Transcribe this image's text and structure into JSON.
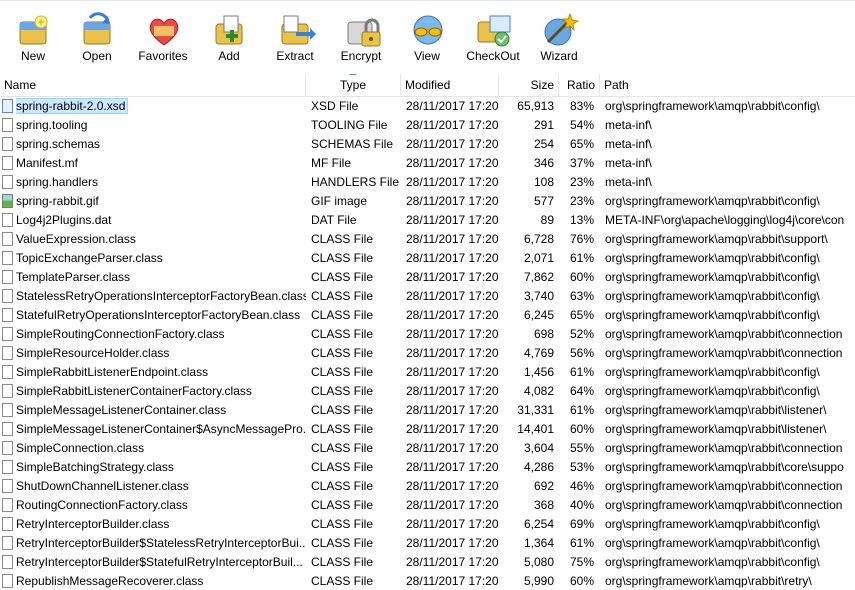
{
  "toolbar": {
    "items": [
      {
        "label": "New",
        "icon": "new-archive-icon"
      },
      {
        "label": "Open",
        "icon": "open-archive-icon"
      },
      {
        "label": "Favorites",
        "icon": "favorites-heart-icon"
      },
      {
        "label": "Add",
        "icon": "add-files-icon"
      },
      {
        "label": "Extract",
        "icon": "extract-icon"
      },
      {
        "label": "Encrypt",
        "icon": "encrypt-lock-icon"
      },
      {
        "label": "View",
        "icon": "view-glasses-icon"
      },
      {
        "label": "CheckOut",
        "icon": "checkout-icon"
      },
      {
        "label": "Wizard",
        "icon": "wizard-icon"
      }
    ]
  },
  "columns": {
    "name": "Name",
    "type": "Type",
    "modified": "Modified",
    "size": "Size",
    "ratio": "Ratio",
    "path": "Path"
  },
  "colors": {
    "selection": "#cce8ff",
    "selection_border": "#99d1ff",
    "sort_arrow": "#5a8fc8"
  },
  "files": [
    {
      "name": "spring-rabbit-2.0.xsd",
      "type": "XSD File",
      "modified": "28/11/2017 17:20",
      "size": "65,913",
      "ratio": "83%",
      "path": "org\\springframework\\amqp\\rabbit\\config\\",
      "icon": "xsd-file-icon",
      "selected": true
    },
    {
      "name": "spring.tooling",
      "type": "TOOLING File",
      "modified": "28/11/2017 17:20",
      "size": "291",
      "ratio": "54%",
      "path": "meta-inf\\",
      "icon": "file-icon"
    },
    {
      "name": "spring.schemas",
      "type": "SCHEMAS File",
      "modified": "28/11/2017 17:20",
      "size": "254",
      "ratio": "65%",
      "path": "meta-inf\\",
      "icon": "file-icon"
    },
    {
      "name": "Manifest.mf",
      "type": "MF File",
      "modified": "28/11/2017 17:20",
      "size": "346",
      "ratio": "37%",
      "path": "meta-inf\\",
      "icon": "file-icon"
    },
    {
      "name": "spring.handlers",
      "type": "HANDLERS File",
      "modified": "28/11/2017 17:20",
      "size": "108",
      "ratio": "23%",
      "path": "meta-inf\\",
      "icon": "file-icon"
    },
    {
      "name": "spring-rabbit.gif",
      "type": "GIF image",
      "modified": "28/11/2017 17:20",
      "size": "577",
      "ratio": "23%",
      "path": "org\\springframework\\amqp\\rabbit\\config\\",
      "icon": "image-file-icon"
    },
    {
      "name": "Log4j2Plugins.dat",
      "type": "DAT File",
      "modified": "28/11/2017 17:20",
      "size": "89",
      "ratio": "13%",
      "path": "META-INF\\org\\apache\\logging\\log4j\\core\\con",
      "icon": "file-icon"
    },
    {
      "name": "ValueExpression.class",
      "type": "CLASS File",
      "modified": "28/11/2017 17:20",
      "size": "6,728",
      "ratio": "76%",
      "path": "org\\springframework\\amqp\\rabbit\\support\\",
      "icon": "file-icon"
    },
    {
      "name": "TopicExchangeParser.class",
      "type": "CLASS File",
      "modified": "28/11/2017 17:20",
      "size": "2,071",
      "ratio": "61%",
      "path": "org\\springframework\\amqp\\rabbit\\config\\",
      "icon": "file-icon"
    },
    {
      "name": "TemplateParser.class",
      "type": "CLASS File",
      "modified": "28/11/2017 17:20",
      "size": "7,862",
      "ratio": "60%",
      "path": "org\\springframework\\amqp\\rabbit\\config\\",
      "icon": "file-icon"
    },
    {
      "name": "StatelessRetryOperationsInterceptorFactoryBean.class",
      "type": "CLASS File",
      "modified": "28/11/2017 17:20",
      "size": "3,740",
      "ratio": "63%",
      "path": "org\\springframework\\amqp\\rabbit\\config\\",
      "icon": "file-icon"
    },
    {
      "name": "StatefulRetryOperationsInterceptorFactoryBean.class",
      "type": "CLASS File",
      "modified": "28/11/2017 17:20",
      "size": "6,245",
      "ratio": "65%",
      "path": "org\\springframework\\amqp\\rabbit\\config\\",
      "icon": "file-icon"
    },
    {
      "name": "SimpleRoutingConnectionFactory.class",
      "type": "CLASS File",
      "modified": "28/11/2017 17:20",
      "size": "698",
      "ratio": "52%",
      "path": "org\\springframework\\amqp\\rabbit\\connection",
      "icon": "file-icon"
    },
    {
      "name": "SimpleResourceHolder.class",
      "type": "CLASS File",
      "modified": "28/11/2017 17:20",
      "size": "4,769",
      "ratio": "56%",
      "path": "org\\springframework\\amqp\\rabbit\\connection",
      "icon": "file-icon"
    },
    {
      "name": "SimpleRabbitListenerEndpoint.class",
      "type": "CLASS File",
      "modified": "28/11/2017 17:20",
      "size": "1,456",
      "ratio": "61%",
      "path": "org\\springframework\\amqp\\rabbit\\config\\",
      "icon": "file-icon"
    },
    {
      "name": "SimpleRabbitListenerContainerFactory.class",
      "type": "CLASS File",
      "modified": "28/11/2017 17:20",
      "size": "4,082",
      "ratio": "64%",
      "path": "org\\springframework\\amqp\\rabbit\\config\\",
      "icon": "file-icon"
    },
    {
      "name": "SimpleMessageListenerContainer.class",
      "type": "CLASS File",
      "modified": "28/11/2017 17:20",
      "size": "31,331",
      "ratio": "61%",
      "path": "org\\springframework\\amqp\\rabbit\\listener\\",
      "icon": "file-icon"
    },
    {
      "name": "SimpleMessageListenerContainer$AsyncMessagePro...",
      "type": "CLASS File",
      "modified": "28/11/2017 17:20",
      "size": "14,401",
      "ratio": "60%",
      "path": "org\\springframework\\amqp\\rabbit\\listener\\",
      "icon": "file-icon"
    },
    {
      "name": "SimpleConnection.class",
      "type": "CLASS File",
      "modified": "28/11/2017 17:20",
      "size": "3,604",
      "ratio": "55%",
      "path": "org\\springframework\\amqp\\rabbit\\connection",
      "icon": "file-icon"
    },
    {
      "name": "SimpleBatchingStrategy.class",
      "type": "CLASS File",
      "modified": "28/11/2017 17:20",
      "size": "4,286",
      "ratio": "53%",
      "path": "org\\springframework\\amqp\\rabbit\\core\\suppo",
      "icon": "file-icon"
    },
    {
      "name": "ShutDownChannelListener.class",
      "type": "CLASS File",
      "modified": "28/11/2017 17:20",
      "size": "692",
      "ratio": "46%",
      "path": "org\\springframework\\amqp\\rabbit\\connection",
      "icon": "file-icon"
    },
    {
      "name": "RoutingConnectionFactory.class",
      "type": "CLASS File",
      "modified": "28/11/2017 17:20",
      "size": "368",
      "ratio": "40%",
      "path": "org\\springframework\\amqp\\rabbit\\connection",
      "icon": "file-icon"
    },
    {
      "name": "RetryInterceptorBuilder.class",
      "type": "CLASS File",
      "modified": "28/11/2017 17:20",
      "size": "6,254",
      "ratio": "69%",
      "path": "org\\springframework\\amqp\\rabbit\\config\\",
      "icon": "file-icon"
    },
    {
      "name": "RetryInterceptorBuilder$StatelessRetryInterceptorBui...",
      "type": "CLASS File",
      "modified": "28/11/2017 17:20",
      "size": "1,364",
      "ratio": "61%",
      "path": "org\\springframework\\amqp\\rabbit\\config\\",
      "icon": "file-icon"
    },
    {
      "name": "RetryInterceptorBuilder$StatefulRetryInterceptorBuil...",
      "type": "CLASS File",
      "modified": "28/11/2017 17:20",
      "size": "5,080",
      "ratio": "75%",
      "path": "org\\springframework\\amqp\\rabbit\\config\\",
      "icon": "file-icon"
    },
    {
      "name": "RepublishMessageRecoverer.class",
      "type": "CLASS File",
      "modified": "28/11/2017 17:20",
      "size": "5,990",
      "ratio": "60%",
      "path": "org\\springframework\\amqp\\rabbit\\retry\\",
      "icon": "file-icon"
    }
  ]
}
